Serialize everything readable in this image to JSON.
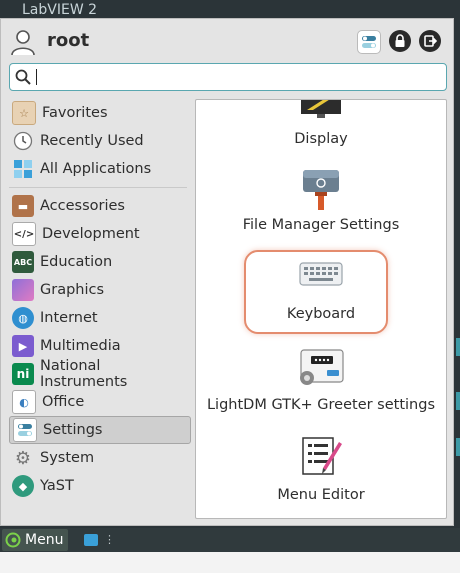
{
  "desktop": {
    "title": "LabVIEW 2"
  },
  "header": {
    "username": "root",
    "buttons": [
      {
        "icon": "settings-toggle-icon"
      },
      {
        "icon": "lock-icon"
      },
      {
        "icon": "logout-icon"
      }
    ]
  },
  "search": {
    "value": "",
    "placeholder": ""
  },
  "sidebar": {
    "pinned": [
      {
        "label": "Favorites",
        "icon": "star-folder-icon"
      },
      {
        "label": "Recently Used",
        "icon": "clock-icon"
      },
      {
        "label": "All Applications",
        "icon": "grid-icon"
      }
    ],
    "categories": [
      {
        "label": "Accessories",
        "icon": "briefcase-icon"
      },
      {
        "label": "Development",
        "icon": "code-icon"
      },
      {
        "label": "Education",
        "icon": "abc-icon"
      },
      {
        "label": "Graphics",
        "icon": "graphics-icon"
      },
      {
        "label": "Internet",
        "icon": "globe-icon"
      },
      {
        "label": "Multimedia",
        "icon": "multimedia-icon"
      },
      {
        "label": "National Instruments",
        "icon": "ni-icon"
      },
      {
        "label": "Office",
        "icon": "office-icon"
      },
      {
        "label": "Settings",
        "icon": "settings-icon",
        "selected": true
      },
      {
        "label": "System",
        "icon": "system-gear-icon"
      },
      {
        "label": "YaST",
        "icon": "yast-icon"
      }
    ]
  },
  "apps": [
    {
      "label": "Display",
      "icon": "display-icon"
    },
    {
      "label": "File Manager Settings",
      "icon": "file-manager-settings-icon"
    },
    {
      "label": "Keyboard",
      "icon": "keyboard-icon",
      "highlighted": true
    },
    {
      "label": "LightDM GTK+ Greeter settings",
      "icon": "lightdm-greeter-icon"
    },
    {
      "label": "Menu Editor",
      "icon": "menu-editor-icon"
    }
  ],
  "taskbar": {
    "menu_label": "Menu"
  },
  "colors": {
    "accent": "#5aa7b0",
    "highlight": "#e48c6e",
    "selected_bg": "#cfcfcf"
  }
}
